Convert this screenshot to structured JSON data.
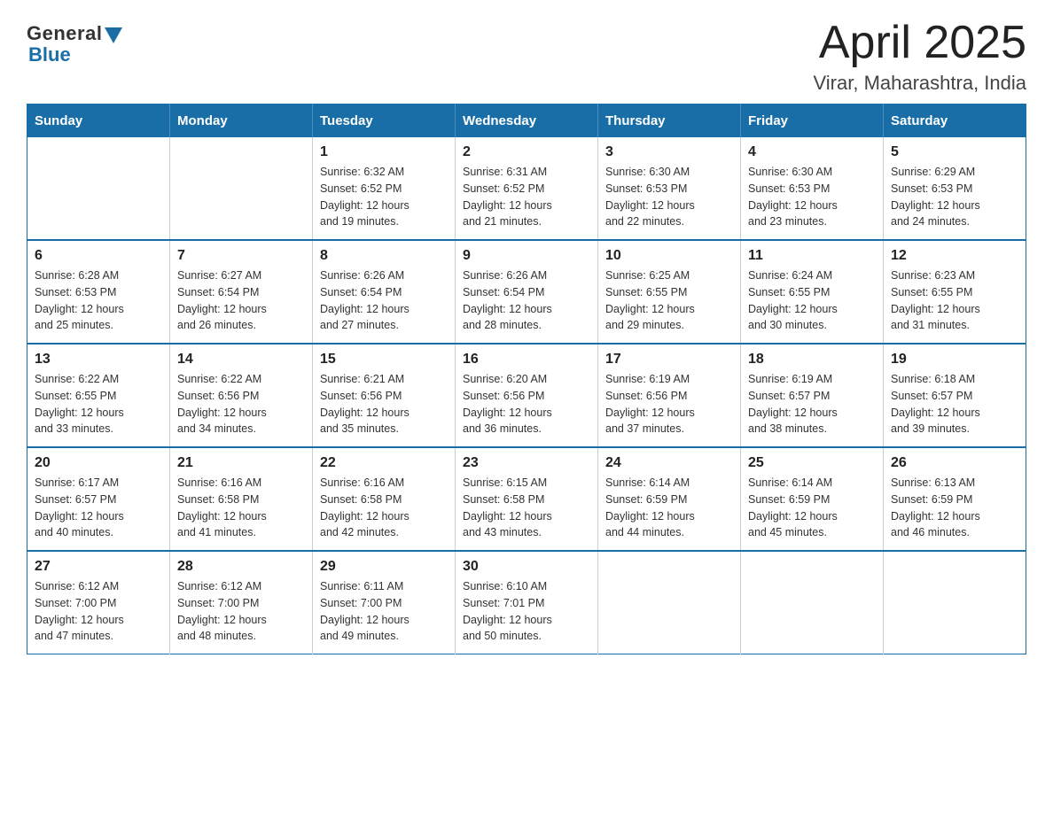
{
  "logo": {
    "general": "General",
    "blue": "Blue"
  },
  "title": "April 2025",
  "subtitle": "Virar, Maharashtra, India",
  "days_of_week": [
    "Sunday",
    "Monday",
    "Tuesday",
    "Wednesday",
    "Thursday",
    "Friday",
    "Saturday"
  ],
  "weeks": [
    [
      {
        "day": "",
        "info": ""
      },
      {
        "day": "",
        "info": ""
      },
      {
        "day": "1",
        "info": "Sunrise: 6:32 AM\nSunset: 6:52 PM\nDaylight: 12 hours\nand 19 minutes."
      },
      {
        "day": "2",
        "info": "Sunrise: 6:31 AM\nSunset: 6:52 PM\nDaylight: 12 hours\nand 21 minutes."
      },
      {
        "day": "3",
        "info": "Sunrise: 6:30 AM\nSunset: 6:53 PM\nDaylight: 12 hours\nand 22 minutes."
      },
      {
        "day": "4",
        "info": "Sunrise: 6:30 AM\nSunset: 6:53 PM\nDaylight: 12 hours\nand 23 minutes."
      },
      {
        "day": "5",
        "info": "Sunrise: 6:29 AM\nSunset: 6:53 PM\nDaylight: 12 hours\nand 24 minutes."
      }
    ],
    [
      {
        "day": "6",
        "info": "Sunrise: 6:28 AM\nSunset: 6:53 PM\nDaylight: 12 hours\nand 25 minutes."
      },
      {
        "day": "7",
        "info": "Sunrise: 6:27 AM\nSunset: 6:54 PM\nDaylight: 12 hours\nand 26 minutes."
      },
      {
        "day": "8",
        "info": "Sunrise: 6:26 AM\nSunset: 6:54 PM\nDaylight: 12 hours\nand 27 minutes."
      },
      {
        "day": "9",
        "info": "Sunrise: 6:26 AM\nSunset: 6:54 PM\nDaylight: 12 hours\nand 28 minutes."
      },
      {
        "day": "10",
        "info": "Sunrise: 6:25 AM\nSunset: 6:55 PM\nDaylight: 12 hours\nand 29 minutes."
      },
      {
        "day": "11",
        "info": "Sunrise: 6:24 AM\nSunset: 6:55 PM\nDaylight: 12 hours\nand 30 minutes."
      },
      {
        "day": "12",
        "info": "Sunrise: 6:23 AM\nSunset: 6:55 PM\nDaylight: 12 hours\nand 31 minutes."
      }
    ],
    [
      {
        "day": "13",
        "info": "Sunrise: 6:22 AM\nSunset: 6:55 PM\nDaylight: 12 hours\nand 33 minutes."
      },
      {
        "day": "14",
        "info": "Sunrise: 6:22 AM\nSunset: 6:56 PM\nDaylight: 12 hours\nand 34 minutes."
      },
      {
        "day": "15",
        "info": "Sunrise: 6:21 AM\nSunset: 6:56 PM\nDaylight: 12 hours\nand 35 minutes."
      },
      {
        "day": "16",
        "info": "Sunrise: 6:20 AM\nSunset: 6:56 PM\nDaylight: 12 hours\nand 36 minutes."
      },
      {
        "day": "17",
        "info": "Sunrise: 6:19 AM\nSunset: 6:56 PM\nDaylight: 12 hours\nand 37 minutes."
      },
      {
        "day": "18",
        "info": "Sunrise: 6:19 AM\nSunset: 6:57 PM\nDaylight: 12 hours\nand 38 minutes."
      },
      {
        "day": "19",
        "info": "Sunrise: 6:18 AM\nSunset: 6:57 PM\nDaylight: 12 hours\nand 39 minutes."
      }
    ],
    [
      {
        "day": "20",
        "info": "Sunrise: 6:17 AM\nSunset: 6:57 PM\nDaylight: 12 hours\nand 40 minutes."
      },
      {
        "day": "21",
        "info": "Sunrise: 6:16 AM\nSunset: 6:58 PM\nDaylight: 12 hours\nand 41 minutes."
      },
      {
        "day": "22",
        "info": "Sunrise: 6:16 AM\nSunset: 6:58 PM\nDaylight: 12 hours\nand 42 minutes."
      },
      {
        "day": "23",
        "info": "Sunrise: 6:15 AM\nSunset: 6:58 PM\nDaylight: 12 hours\nand 43 minutes."
      },
      {
        "day": "24",
        "info": "Sunrise: 6:14 AM\nSunset: 6:59 PM\nDaylight: 12 hours\nand 44 minutes."
      },
      {
        "day": "25",
        "info": "Sunrise: 6:14 AM\nSunset: 6:59 PM\nDaylight: 12 hours\nand 45 minutes."
      },
      {
        "day": "26",
        "info": "Sunrise: 6:13 AM\nSunset: 6:59 PM\nDaylight: 12 hours\nand 46 minutes."
      }
    ],
    [
      {
        "day": "27",
        "info": "Sunrise: 6:12 AM\nSunset: 7:00 PM\nDaylight: 12 hours\nand 47 minutes."
      },
      {
        "day": "28",
        "info": "Sunrise: 6:12 AM\nSunset: 7:00 PM\nDaylight: 12 hours\nand 48 minutes."
      },
      {
        "day": "29",
        "info": "Sunrise: 6:11 AM\nSunset: 7:00 PM\nDaylight: 12 hours\nand 49 minutes."
      },
      {
        "day": "30",
        "info": "Sunrise: 6:10 AM\nSunset: 7:01 PM\nDaylight: 12 hours\nand 50 minutes."
      },
      {
        "day": "",
        "info": ""
      },
      {
        "day": "",
        "info": ""
      },
      {
        "day": "",
        "info": ""
      }
    ]
  ]
}
